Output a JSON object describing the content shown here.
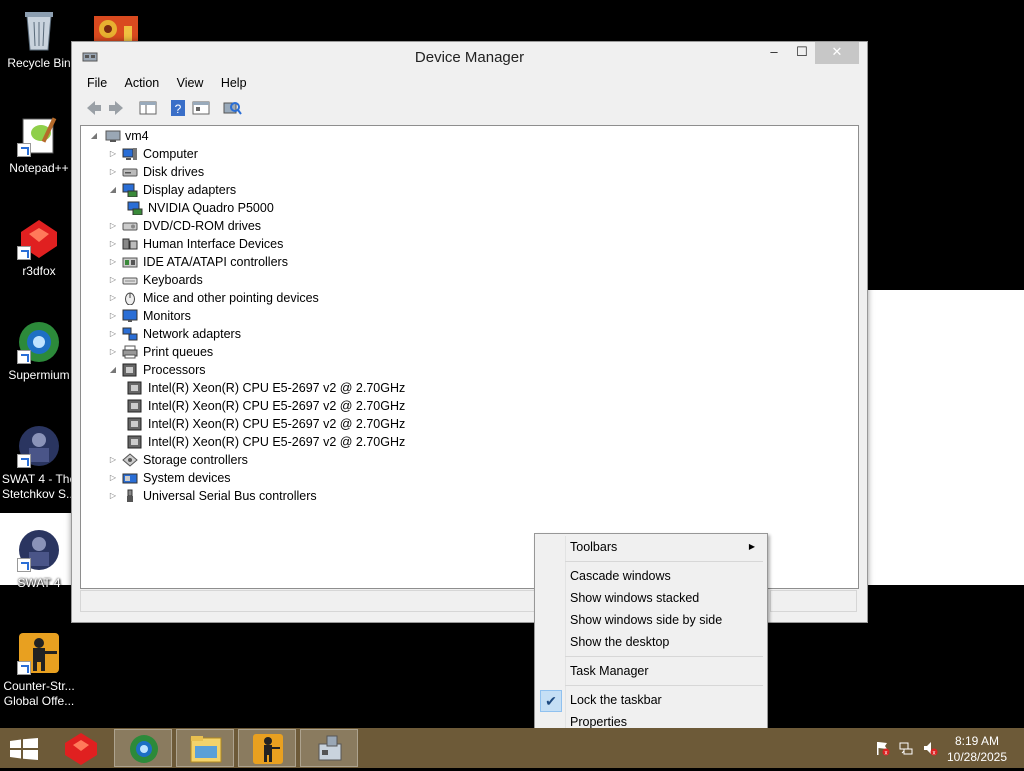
{
  "desktop": {
    "icons": [
      {
        "label": "Recycle Bin"
      },
      {
        "label": "Notepad++"
      },
      {
        "label": "r3dfox"
      },
      {
        "label": "Supermium"
      },
      {
        "label": "SWAT 4 - The Stetchkov S..."
      },
      {
        "label": "SWAT 4"
      },
      {
        "label": "Counter-Str... Global Offe..."
      }
    ]
  },
  "window": {
    "title": "Device Manager",
    "controls": {
      "minimize": "–",
      "maximize": "☐",
      "close": "✕"
    },
    "menu": [
      "File",
      "Action",
      "View",
      "Help"
    ]
  },
  "tree": {
    "root": "vm4",
    "nodes": [
      {
        "label": "Computer",
        "icon": "computer-icon",
        "expanded": false
      },
      {
        "label": "Disk drives",
        "icon": "disk-drive-icon",
        "expanded": false
      },
      {
        "label": "Display adapters",
        "icon": "display-adapter-icon",
        "expanded": true
      },
      {
        "label": "NVIDIA Quadro P5000",
        "icon": "display-adapter-icon",
        "child": true
      },
      {
        "label": "DVD/CD-ROM drives",
        "icon": "dvd-drive-icon",
        "expanded": false
      },
      {
        "label": "Human Interface Devices",
        "icon": "hid-icon",
        "expanded": false
      },
      {
        "label": "IDE ATA/ATAPI controllers",
        "icon": "ide-controller-icon",
        "expanded": false
      },
      {
        "label": "Keyboards",
        "icon": "keyboard-icon",
        "expanded": false
      },
      {
        "label": "Mice and other pointing devices",
        "icon": "mouse-icon",
        "expanded": false
      },
      {
        "label": "Monitors",
        "icon": "monitor-icon",
        "expanded": false
      },
      {
        "label": "Network adapters",
        "icon": "network-adapter-icon",
        "expanded": false
      },
      {
        "label": "Print queues",
        "icon": "printer-icon",
        "expanded": false
      },
      {
        "label": "Processors",
        "icon": "processor-icon",
        "expanded": true
      },
      {
        "label": "Intel(R) Xeon(R) CPU E5-2697 v2 @ 2.70GHz",
        "icon": "processor-icon",
        "child": true
      },
      {
        "label": "Intel(R) Xeon(R) CPU E5-2697 v2 @ 2.70GHz",
        "icon": "processor-icon",
        "child": true
      },
      {
        "label": "Intel(R) Xeon(R) CPU E5-2697 v2 @ 2.70GHz",
        "icon": "processor-icon",
        "child": true
      },
      {
        "label": "Intel(R) Xeon(R) CPU E5-2697 v2 @ 2.70GHz",
        "icon": "processor-icon",
        "child": true
      },
      {
        "label": "Storage controllers",
        "icon": "storage-controller-icon",
        "expanded": false
      },
      {
        "label": "System devices",
        "icon": "system-device-icon",
        "expanded": false
      },
      {
        "label": "Universal Serial Bus controllers",
        "icon": "usb-icon",
        "expanded": false
      }
    ]
  },
  "context_menu": {
    "toolbars": "Toolbars",
    "cascade": "Cascade windows",
    "stacked": "Show windows stacked",
    "side_by_side": "Show windows side by side",
    "show_desktop": "Show the desktop",
    "task_manager": "Task Manager",
    "lock_taskbar": "Lock the taskbar",
    "lock_checked": true,
    "properties": "Properties",
    "check_mark": "✔"
  },
  "taskbar": {
    "apps": [
      "r3dfox",
      "Supermium",
      "File Explorer",
      "Counter-Strike",
      "Device Manager"
    ],
    "tray": [
      "action-center-flag-icon",
      "network-icon",
      "volume-muted-icon"
    ],
    "time": "8:19 AM",
    "date": "10/28/2025"
  },
  "colors": {
    "taskbar": "#6d5a38",
    "accent": "#2a6ed6",
    "close_button": "#c7c7c7"
  }
}
